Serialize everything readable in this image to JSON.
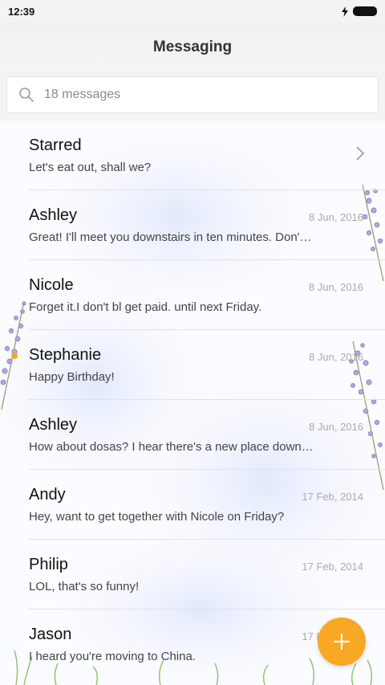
{
  "status_bar": {
    "time": "12:39"
  },
  "header": {
    "title": "Messaging"
  },
  "search": {
    "placeholder": "18 messages"
  },
  "conversations": [
    {
      "name": "Starred",
      "preview": "Let's eat out, shall we?",
      "date": ""
    },
    {
      "name": "Ashley",
      "preview": "Great! I'll meet you downstairs in ten minutes. Don't be late!",
      "date": "8 Jun, 2016"
    },
    {
      "name": "Nicole",
      "preview": "Forget it.I don't bl get paid. until next Friday.",
      "date": "8 Jun, 2016"
    },
    {
      "name": "Stephanie",
      "preview": "Happy Birthday!",
      "date": "8 Jun, 2016"
    },
    {
      "name": "Ashley",
      "preview": "How about dosas? I hear there's a new place down the street.",
      "date": "8 Jun, 2016"
    },
    {
      "name": "Andy",
      "preview": "Hey, want to get together with Nicole on Friday?",
      "date": "17 Feb, 2014"
    },
    {
      "name": "Philip",
      "preview": "LOL, that's so funny!",
      "date": "17 Feb, 2014"
    },
    {
      "name": "Jason",
      "preview": "I heard you're moving to China.",
      "date": "17 Feb, 2014"
    }
  ],
  "colors": {
    "accent": "#f7a824",
    "unread": "#f5a623"
  },
  "icons": {
    "search": "search-icon",
    "compose": "plus-icon",
    "chevron": "chevron-right-icon"
  }
}
